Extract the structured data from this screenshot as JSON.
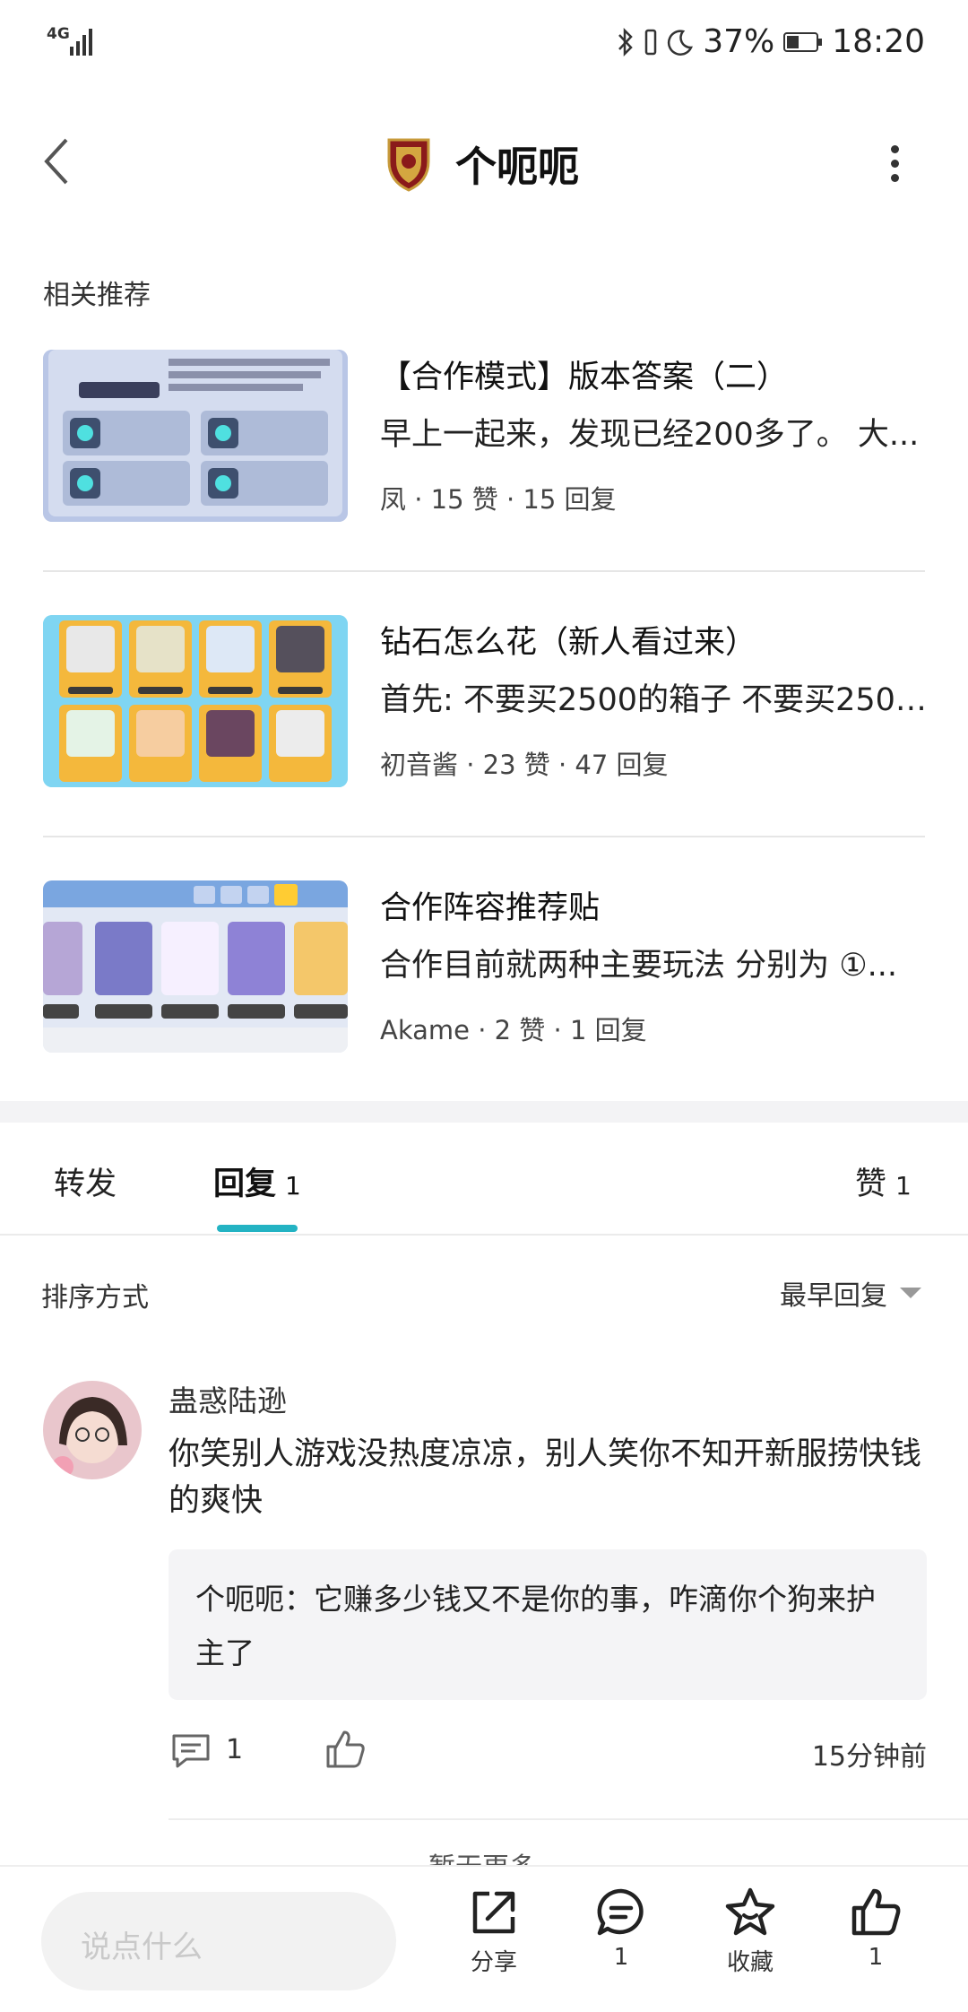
{
  "status": {
    "network": "4G",
    "battery": "37%",
    "time": "18:20"
  },
  "header": {
    "title": "个呃呃"
  },
  "section_label": "相关推荐",
  "recommendations": [
    {
      "title": "【合作模式】版本答案（二）",
      "desc": "早上一起来，发现已经200多了。 大...",
      "meta": "凤 · 15 赞 · 15 回复"
    },
    {
      "title": "钻石怎么花（新人看过来）",
      "desc": "首先: 不要买2500的箱子 不要买2500...",
      "meta": "初音酱 · 23 赞 · 47 回复"
    },
    {
      "title": "合作阵容推荐贴",
      "desc": "合作目前就两种主要玩法 分别为 ①...",
      "meta": "Akame · 2 赞 · 1 回复"
    }
  ],
  "tabs": {
    "forward": "转发",
    "reply": "回复",
    "reply_count": "1",
    "like": "赞",
    "like_count": "1"
  },
  "sort": {
    "label": "排序方式",
    "value": "最早回复"
  },
  "comment": {
    "user": "蛊惑陆逊",
    "text": "你笑别人游戏没热度凉凉，别人笑你不知开新服捞快钱的爽快",
    "quote": "个呃呃：它赚多少钱又不是你的事，咋滴你个狗来护主了",
    "reply_count": "1",
    "time": "15分钟前"
  },
  "no_more": "暂无更多",
  "bottom": {
    "placeholder": "说点什么",
    "share": "分享",
    "comment_count": "1",
    "favorite": "收藏",
    "like_count": "1"
  },
  "colors": {
    "accent": "#23b3c3",
    "divider": "#e6e6e6"
  }
}
